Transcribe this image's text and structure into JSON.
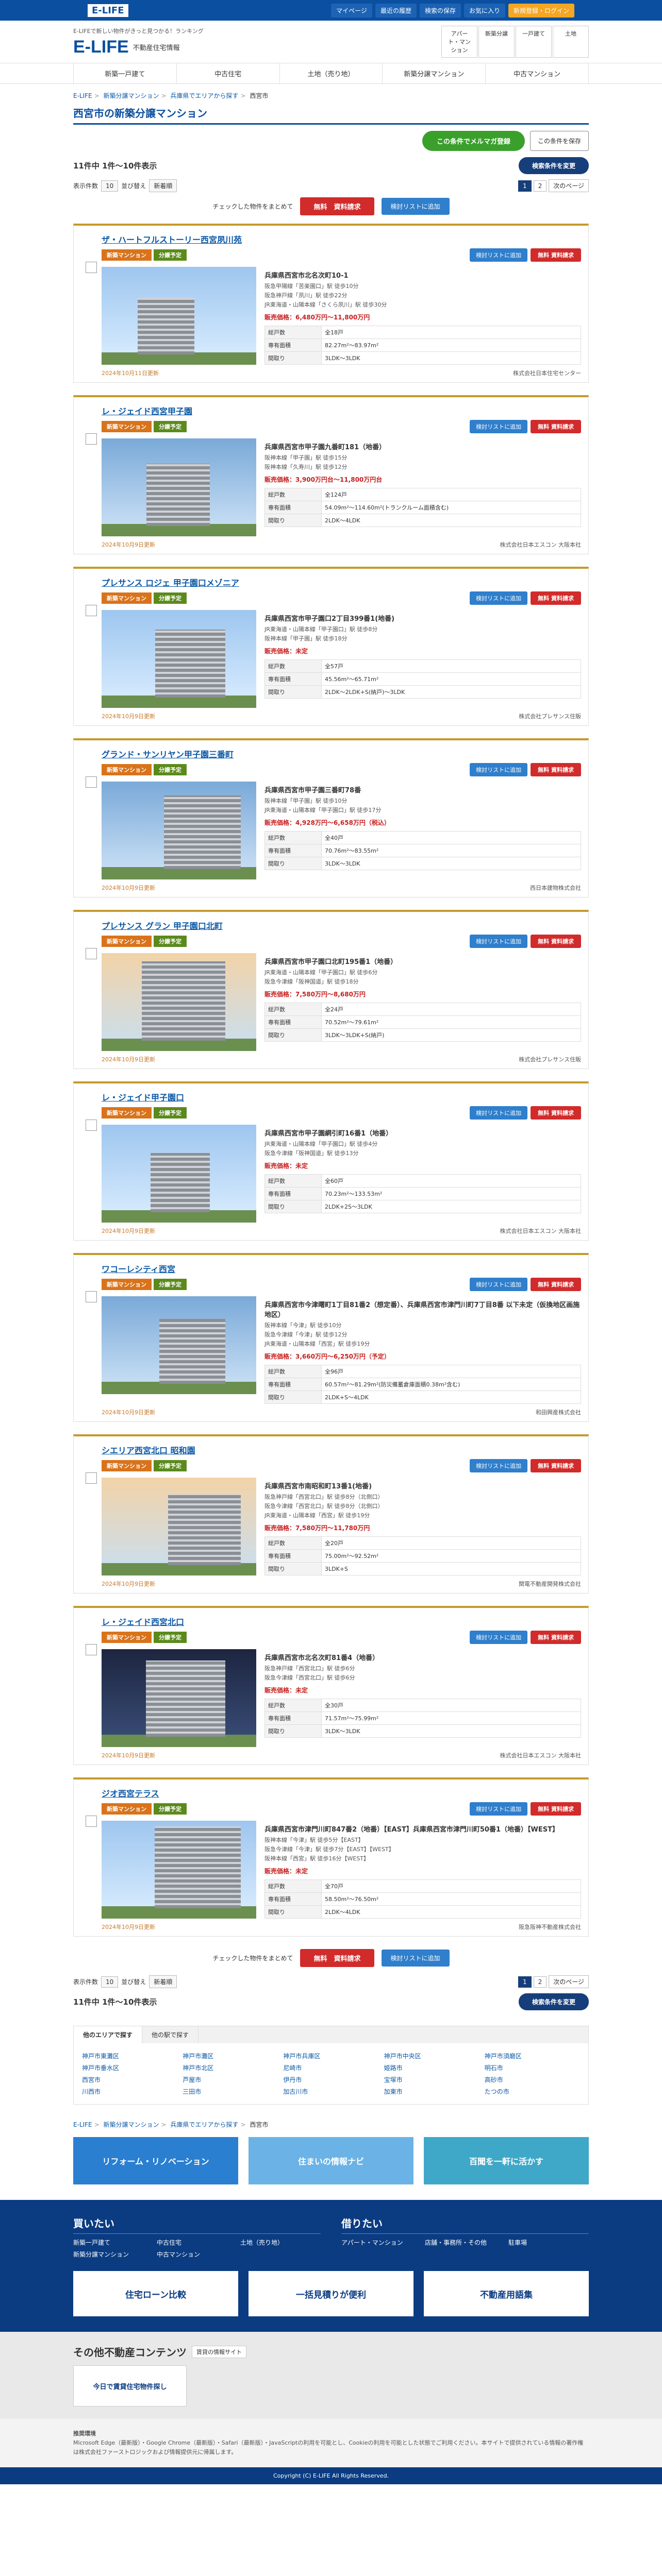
{
  "topbar": {
    "logo": "E-LIFE",
    "nav": [
      "マイページ",
      "最近の履歴",
      "検索の保存",
      "お気に入り"
    ],
    "login": "新規登録・ログイン"
  },
  "header": {
    "tagline": "E-LIFEで新しい物件がきっと見つかる！ランキング",
    "logo": "E-LIFE",
    "logo_sub": "不動産住宅情報",
    "links": [
      "アパート・マンション",
      "新築分譲",
      "一戸建て",
      "土地"
    ]
  },
  "gnav": [
    "新築一戸建て",
    "中古住宅",
    "土地（売り地）",
    "新築分譲マンション",
    "中古マンション"
  ],
  "breadcrumb": [
    "E-LIFE",
    "新築分譲マンション",
    "兵庫県でエリアから探す",
    "西宮市"
  ],
  "page": {
    "title": "西宮市の新築分譲マンション",
    "mail_button": "この条件でメルマガ登録",
    "save_button": "この条件を保存",
    "count": "11件中 1件～10件表示",
    "search_button": "検索条件を変更",
    "per_page_label": "表示件数",
    "per_page_value": "10",
    "sort_label": "並び替え",
    "sort_value": "新着順",
    "pager": [
      "1",
      "2",
      "次のページ"
    ],
    "check_label": "チェックした物件をまとめて",
    "request_button": "無料　資料請求",
    "fav_button": "検討リストに追加"
  },
  "card_labels": {
    "tag_new": "新築マンション",
    "tag_sale": "分譲予定",
    "fav": "検討リストに追加",
    "request": "無料 資料請求",
    "spec_units": "総戸数",
    "spec_area": "専有面積",
    "spec_layout": "間取り"
  },
  "properties": [
    {
      "name": "ザ・ハートフルストーリー西宮夙川苑",
      "address": "兵庫県西宮市北名次町10-1",
      "stations": [
        "阪急甲陽線「苦楽園口」駅 徒歩10分",
        "阪急神戸線「夙川」駅 徒歩22分",
        "JR東海道・山陽本線「さくら夙川」駅 徒歩30分"
      ],
      "price": "販売価格：6,480万円～11,800万円",
      "units": "全18戸",
      "area": "82.27m²～83.97m²",
      "layout": "3LDK～3LDK",
      "date": "2024年10月11日更新",
      "company": "株式会社日本住宅センター"
    },
    {
      "name": "レ・ジェイド西宮甲子園",
      "address": "兵庫県西宮市甲子園九番町181（地番）",
      "stations": [
        "阪神本線「甲子園」駅 徒歩15分",
        "阪神本線「久寿川」駅 徒歩12分"
      ],
      "price": "販売価格：3,900万円台～11,800万円台",
      "units": "全124戸",
      "area": "54.09m²～114.60m²(トランクルーム面積含む)",
      "layout": "2LDK～4LDK",
      "date": "2024年10月9日更新",
      "company": "株式会社日本エスコン 大阪本社"
    },
    {
      "name": "プレサンス ロジェ 甲子園口メゾニア",
      "address": "兵庫県西宮市甲子園口2丁目399番1(地番)",
      "stations": [
        "JR東海道・山陽本線「甲子園口」駅 徒歩8分",
        "阪神本線「甲子園」駅 徒歩18分"
      ],
      "price": "販売価格：未定",
      "units": "全57戸",
      "area": "45.56m²～65.71m²",
      "layout": "2LDK～2LDK+S(納戸)～3LDK",
      "date": "2024年10月9日更新",
      "company": "株式会社プレサンス住販"
    },
    {
      "name": "グランド・サンリヤン甲子園三番町",
      "address": "兵庫県西宮市甲子園三番町78番",
      "stations": [
        "阪神本線「甲子園」駅 徒歩10分",
        "JR東海道・山陽本線「甲子園口」駅 徒歩17分"
      ],
      "price": "販売価格：4,928万円～6,658万円（税込）",
      "units": "全40戸",
      "area": "70.76m²～83.55m²",
      "layout": "3LDK～3LDK",
      "date": "2024年10月9日更新",
      "company": "西日本建物株式会社"
    },
    {
      "name": "プレサンス グラン 甲子園口北町",
      "address": "兵庫県西宮市甲子園口北町195番1（地番）",
      "stations": [
        "JR東海道・山陽本線「甲子園口」駅 徒歩6分",
        "阪急今津線「阪神国道」駅 徒歩18分"
      ],
      "price": "販売価格：7,580万円～8,680万円",
      "units": "全24戸",
      "area": "70.52m²～79.61m²",
      "layout": "3LDK～3LDK+S(納戸)",
      "date": "2024年10月9日更新",
      "company": "株式会社プレサンス住販"
    },
    {
      "name": "レ・ジェイド甲子園口",
      "address": "兵庫県西宮市甲子園網引町16番1（地番）",
      "stations": [
        "JR東海道・山陽本線「甲子園口」駅 徒歩4分",
        "阪急今津線「阪神国道」駅 徒歩13分"
      ],
      "price": "販売価格：未定",
      "units": "全60戸",
      "area": "70.23m²～133.53m²",
      "layout": "2LDK+2S～3LDK",
      "date": "2024年10月9日更新",
      "company": "株式会社日本エスコン 大阪本社"
    },
    {
      "name": "ワコーレシティ西宮",
      "address": "兵庫県西宮市今津曙町1丁目81番2（想定番）、兵庫県西宮市津門川町7丁目8番 以下未定（仮換地区画施地区）",
      "stations": [
        "阪神本線「今津」駅 徒歩10分",
        "阪急今津線「今津」駅 徒歩12分",
        "JR東海道・山陽本線「西宮」駅 徒歩19分"
      ],
      "price": "販売価格：3,660万円～6,250万円（予定）",
      "units": "全96戸",
      "area": "60.57m²～81.29m²(防災備蓄倉庫面積0.38m²含む)",
      "layout": "2LDK+S～4LDK",
      "date": "2024年10月9日更新",
      "company": "和田興産株式会社"
    },
    {
      "name": "シエリア西宮北口 昭和園",
      "address": "兵庫県西宮市南昭和町13番1(地番)",
      "stations": [
        "阪急神戸線「西宮北口」駅 徒歩8分（北側口）",
        "阪急今津線「西宮北口」駅 徒歩8分（北側口）",
        "JR東海道・山陽本線「西宮」駅 徒歩19分"
      ],
      "price": "販売価格：7,580万円～11,780万円",
      "units": "全20戸",
      "area": "75.00m²～92.52m²",
      "layout": "3LDK+S",
      "date": "2024年10月9日更新",
      "company": "関電不動産開発株式会社"
    },
    {
      "name": "レ・ジェイド西宮北口",
      "address": "兵庫県西宮市北名次町81番4（地番）",
      "stations": [
        "阪急神戸線「西宮北口」駅 徒歩6分",
        "阪急今津線「西宮北口」駅 徒歩6分"
      ],
      "price": "販売価格：未定",
      "units": "全30戸",
      "area": "71.57m²～75.99m²",
      "layout": "3LDK～3LDK",
      "date": "2024年10月9日更新",
      "company": "株式会社日本エスコン 大阪本社"
    },
    {
      "name": "ジオ西宮テラス",
      "address": "兵庫県西宮市津門川町847番2（地番）【EAST】兵庫県西宮市津門川町50番1（地番）【WEST】",
      "stations": [
        "阪神本線「今津」駅 徒歩5分【EAST】",
        "阪急今津線「今津」駅 徒歩7分【EAST】【WEST】",
        "阪神本線「西宮」駅 徒歩16分【WEST】"
      ],
      "price": "販売価格：未定",
      "units": "全70戸",
      "area": "58.50m²～76.50m²",
      "layout": "2LDK～4LDK",
      "date": "2024年10月9日更新",
      "company": "阪急阪神不動産株式会社"
    }
  ],
  "area": {
    "tabs": [
      "他のエリアで探す",
      "他の駅で探す"
    ],
    "cities": [
      "神戸市東灘区",
      "神戸市灘区",
      "神戸市兵庫区",
      "神戸市中央区",
      "神戸市須磨区",
      "神戸市垂水区",
      "神戸市北区",
      "尼崎市",
      "姫路市",
      "明石市",
      "西宮市",
      "芦屋市",
      "伊丹市",
      "宝塚市",
      "高砂市",
      "川西市",
      "三田市",
      "加古川市",
      "加東市",
      "たつの市"
    ]
  },
  "banners": [
    "リフォーム・リノベーション",
    "住まいの情報ナビ",
    "百聞を一軒に活かす"
  ],
  "footer": {
    "buy_title": "買いたい",
    "buy_items": [
      "新築一戸建て",
      "中古住宅",
      "土地（売り地）",
      "新築分譲マンション",
      "中古マンション"
    ],
    "rent_title": "借りたい",
    "rent_items": [
      "アパート・マンション",
      "店舗・事務所・その他",
      "駐車場"
    ],
    "banners": [
      "住宅ローン比較",
      "一括見積りが便利",
      "不動産用語集"
    ]
  },
  "other": {
    "title": "その他不動産コンテンツ",
    "badge": "賃貸の情報サイト",
    "banners": [
      "今日で賃貸住宅物件探し"
    ]
  },
  "notes": {
    "heading": "推奨環境",
    "text": "Microsoft Edge（最新版）・Google Chrome（最新版）・Safari（最新版）・JavaScriptの利用を可能とし、Cookieの利用を可能とした状態でご利用ください。本サイトで提供されている情報の著作権は株式会社ファーストロジックおよび情報提供元に帰属します。"
  },
  "copyright": "Copyright (C) E-LIFE All Rights Reserved."
}
